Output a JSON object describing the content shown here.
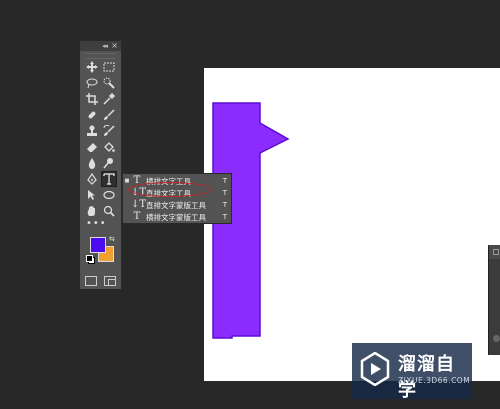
{
  "canvas": {
    "background": "#ffffff",
    "shape_color": "#8b2cff",
    "shape_stroke": "#5a0fd0"
  },
  "toolbox": {
    "collapse_glyph": "◂◂",
    "close_glyph": "×",
    "tools": [
      [
        "move-tool",
        "marquee-tool"
      ],
      [
        "lasso-tool",
        "quick-select-tool"
      ],
      [
        "crop-tool",
        "eyedropper-tool"
      ],
      [
        "healing-brush-tool",
        "brush-tool"
      ],
      [
        "clone-stamp-tool",
        "history-brush-tool"
      ],
      [
        "eraser-tool",
        "paint-bucket-tool"
      ],
      [
        "blur-tool",
        "dodge-tool"
      ],
      [
        "pen-tool",
        "type-tool"
      ],
      [
        "path-selection-tool",
        "ellipse-tool"
      ],
      [
        "hand-tool",
        "zoom-tool"
      ]
    ],
    "more_glyph": "•••",
    "foreground_color": "#4b0cf0",
    "background_color": "#f0a030"
  },
  "flyout": {
    "items": [
      {
        "bullet": "■",
        "icon": "T",
        "label": "横排文字工具",
        "key": "T"
      },
      {
        "bullet": "",
        "icon": "↓T",
        "label": "直排文字工具",
        "key": "T"
      },
      {
        "bullet": "",
        "icon": "↓T",
        "label": "直排文字蒙版工具",
        "key": "T"
      },
      {
        "bullet": "",
        "icon": "T",
        "label": "横排文字蒙版工具",
        "key": "T"
      }
    ]
  },
  "watermark": {
    "title": "溜溜自学",
    "url": "ZIXUE.3D66.COM"
  }
}
